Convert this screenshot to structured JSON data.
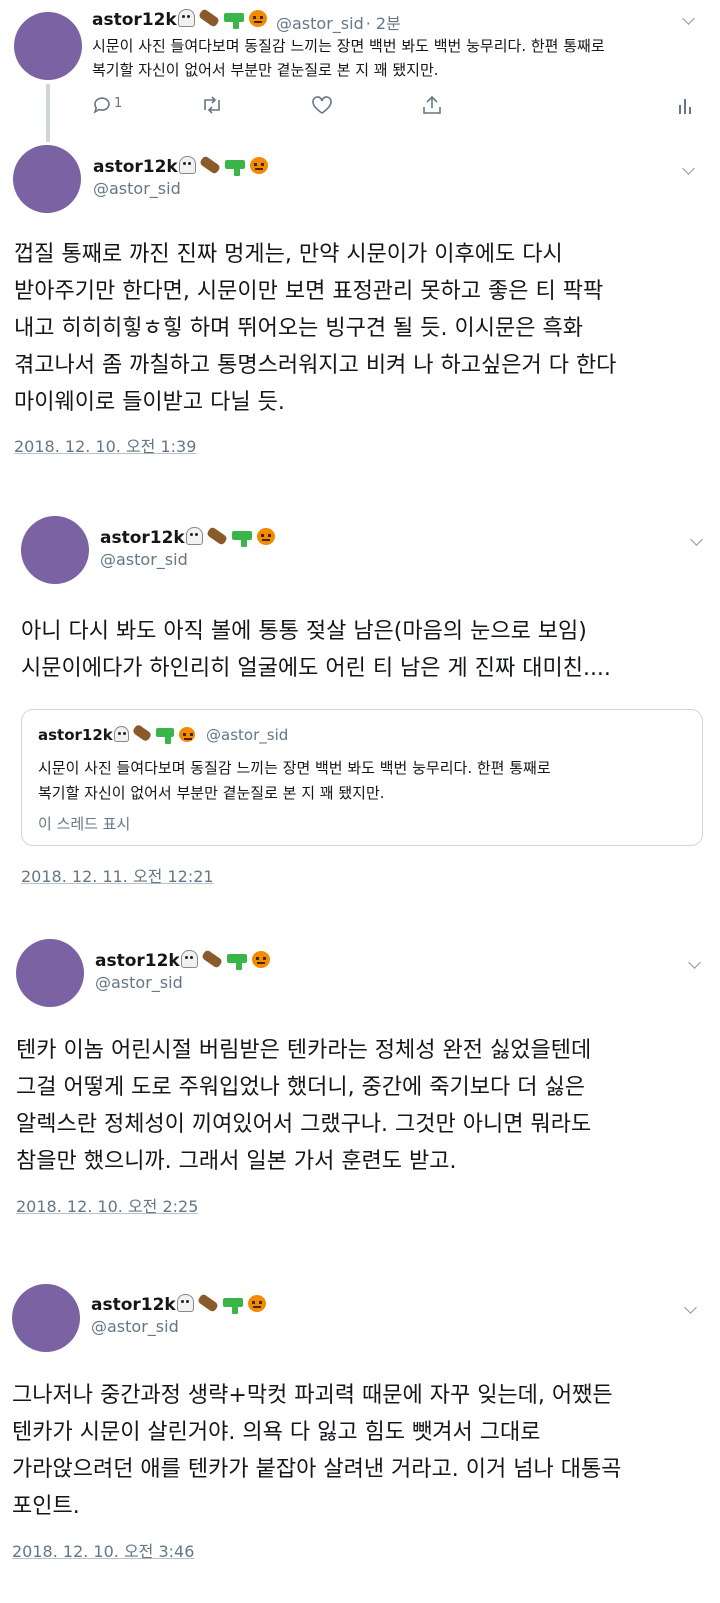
{
  "tweets": [
    {
      "name": "astor12k",
      "handle": "@astor_sid",
      "time_ago": "· 2분",
      "text": "시문이 사진 들여다보며 동질감 느끼는 장면 백번 봐도 백번 눙무리다. 한편 통째로\n복기할 자신이 없어서 부분만 곁눈질로 본 지 꽤 됐지만.",
      "reply_count": "1"
    },
    {
      "name": "astor12k",
      "handle": "@astor_sid",
      "text": "껍질 통째로 까진 진짜 멍게는, 만약 시문이가 이후에도 다시\n받아주기만 한다면, 시문이만 보면 표정관리 못하고 좋은 티 팍팍\n내고 히히히힣ㅎ힣 하며 뛰어오는 빙구견 될 듯. 이시문은 흑화\n겪고나서 좀 까칠하고 통명스러워지고 비켜 나 하고싶은거 다 한다\n마이웨이로 들이받고 다닐 듯.",
      "timestamp": "2018. 12. 10. 오전 1:39"
    },
    {
      "name": "astor12k",
      "handle": "@astor_sid",
      "text": "아니 다시 봐도 아직 볼에 통통 젖살 남은(마음의 눈으로 보임)\n시문이에다가 하인리히 얼굴에도 어린 티 남은 게 진짜 대미친....",
      "quote": {
        "name": "astor12k",
        "handle": "@astor_sid",
        "text": "시문이 사진 들여다보며 동질감 느끼는 장면 백번 봐도 백번 눙무리다. 한편 통째로\n복기할 자신이 없어서 부분만 곁눈질로 본 지 꽤 됐지만.",
        "show_thread": "이 스레드 표시"
      },
      "timestamp": "2018. 12. 11. 오전 12:21"
    },
    {
      "name": "astor12k",
      "handle": "@astor_sid",
      "text": "텐카 이놈 어린시절 버림받은 텐카라는 정체성 완전 싫었을텐데\n그걸 어떻게 도로 주워입었나 했더니, 중간에 죽기보다 더 싫은\n알렉스란 정체성이 끼여있어서 그랬구나. 그것만 아니면 뭐라도\n참을만 했으니까. 그래서 일본 가서 훈련도 받고.",
      "timestamp": "2018. 12. 10. 오전 2:25"
    },
    {
      "name": "astor12k",
      "handle": "@astor_sid",
      "text": "그나저나 중간과정 생략+막컷 파괴력 때문에 자꾸 잊는데, 어쨌든\n텐카가 시문이 살린거야. 의욕 다 잃고 힘도 뺏겨서 그대로\n가라앉으려던 애를 텐카가 붙잡아 살려낸 거라고. 이거 넘나 대통곡\n포인트.",
      "timestamp": "2018. 12. 10. 오전 3:46"
    }
  ],
  "colors": {
    "avatar": "#7a62a3",
    "secondary_text": "#657786",
    "border": "#ccd6dd"
  },
  "icons": [
    "ghost-emoji",
    "coffin-emoji",
    "water-pistol-emoji",
    "jack-o-lantern-emoji",
    "reply-icon",
    "retweet-icon",
    "like-icon",
    "share-icon",
    "analytics-icon",
    "chevron-down-icon"
  ]
}
